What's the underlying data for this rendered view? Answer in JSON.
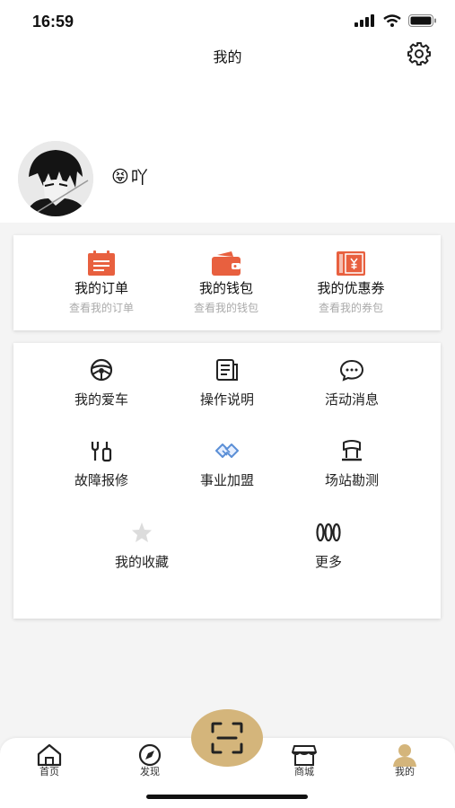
{
  "status_bar": {
    "time": "16:59"
  },
  "header": {
    "title": "我的"
  },
  "profile": {
    "emoji": "😝",
    "nickname": "吖"
  },
  "wallet_card": {
    "items": [
      {
        "label": "我的订单",
        "sub": "查看我的订单",
        "icon": "order-clipboard-icon"
      },
      {
        "label": "我的钱包",
        "sub": "查看我的钱包",
        "icon": "wallet-icon"
      },
      {
        "label": "我的优惠券",
        "sub": "查看我的券包",
        "icon": "coupon-icon"
      }
    ]
  },
  "services": {
    "items": [
      {
        "label": "我的爱车",
        "icon": "steering-wheel-icon"
      },
      {
        "label": "操作说明",
        "icon": "document-icon"
      },
      {
        "label": "活动消息",
        "icon": "chat-bubble-icon"
      },
      {
        "label": "故障报修",
        "icon": "wrench-icon"
      },
      {
        "label": "事业加盟",
        "icon": "handshake-icon"
      },
      {
        "label": "场站勘测",
        "icon": "survey-flag-icon"
      },
      {
        "label": "我的收藏",
        "icon": "star-icon"
      },
      {
        "label": "更多",
        "icon": "more-icon"
      }
    ]
  },
  "tabbar": {
    "items": [
      {
        "label": "首页",
        "icon": "home-icon"
      },
      {
        "label": "发现",
        "icon": "compass-icon"
      },
      {
        "label": "商城",
        "icon": "store-icon"
      },
      {
        "label": "我的",
        "icon": "user-icon",
        "active": true
      }
    ],
    "scan_icon": "scan-icon"
  },
  "colors": {
    "accent": "#e8603f",
    "gold": "#d4b57b",
    "icon_blue": "#5b8fd6"
  }
}
